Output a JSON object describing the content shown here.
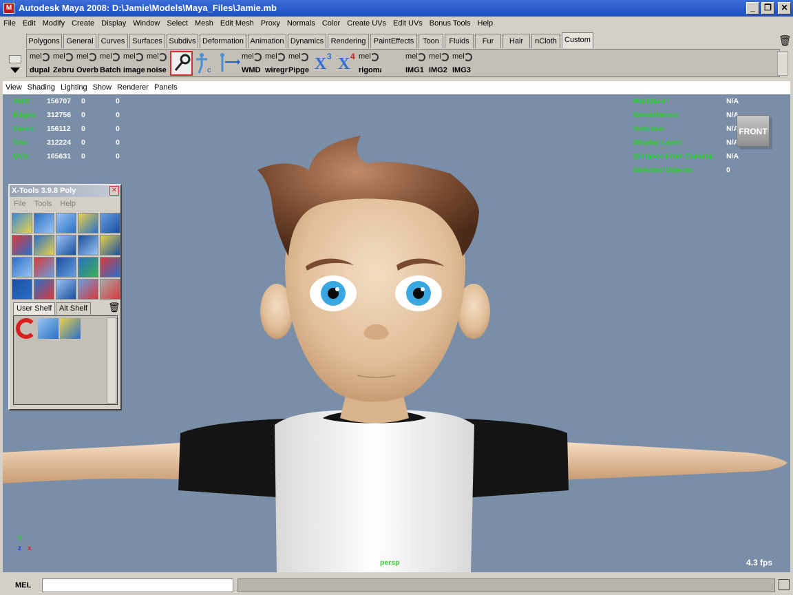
{
  "window": {
    "title": "Autodesk Maya 2008: D:\\Jamie\\Models\\Maya_Files\\Jamie.mb"
  },
  "menubar": [
    "File",
    "Edit",
    "Modify",
    "Create",
    "Display",
    "Window",
    "Select",
    "Mesh",
    "Edit Mesh",
    "Proxy",
    "Normals",
    "Color",
    "Create UVs",
    "Edit UVs",
    "Bonus Tools",
    "Help"
  ],
  "shelf_tabs": [
    "Polygons",
    "General",
    "Curves",
    "Surfaces",
    "Subdivs",
    "Deformation",
    "Animation",
    "Dynamics",
    "Rendering",
    "PaintEffects",
    "Toon",
    "Fluids",
    "Fur",
    "Hair",
    "nCloth",
    "Custom"
  ],
  "shelf_active_tab": "Custom",
  "shelf_items": [
    {
      "mel": "mel",
      "label": "dupal"
    },
    {
      "mel": "mel",
      "label": "Zebru"
    },
    {
      "mel": "mel",
      "label": "Overb"
    },
    {
      "mel": "mel",
      "label": "Batch"
    },
    {
      "mel": "mel",
      "label": "image"
    },
    {
      "mel": "mel",
      "label": "noise"
    },
    {
      "mel": "",
      "label": ""
    },
    {
      "mel": "",
      "label": ""
    },
    {
      "mel": "",
      "label": ""
    },
    {
      "mel": "mel",
      "label": "WMD"
    },
    {
      "mel": "mel",
      "label": "wiregr"
    },
    {
      "mel": "mel",
      "label": "Pipge"
    },
    {
      "mel": "",
      "label": ""
    },
    {
      "mel": "",
      "label": ""
    },
    {
      "mel": "mel",
      "label": "rigoma"
    },
    {
      "mel": "mel",
      "label": "IMG1"
    },
    {
      "mel": "mel",
      "label": "IMG2"
    },
    {
      "mel": "mel",
      "label": "IMG3"
    }
  ],
  "shelf_badges": {
    "x3": "3",
    "x4": "4"
  },
  "panel_menu": [
    "View",
    "Shading",
    "Lighting",
    "Show",
    "Renderer",
    "Panels"
  ],
  "hud_left": [
    {
      "label": "Verts:",
      "v1": "156707",
      "v2": "0",
      "v3": "0"
    },
    {
      "label": "Edges:",
      "v1": "312756",
      "v2": "0",
      "v3": "0"
    },
    {
      "label": "Faces:",
      "v1": "156112",
      "v2": "0",
      "v3": "0"
    },
    {
      "label": "Tris:",
      "v1": "312224",
      "v2": "0",
      "v3": "0"
    },
    {
      "label": "UVs:",
      "v1": "165631",
      "v2": "0",
      "v3": "0"
    }
  ],
  "hud_right": [
    {
      "label": "Backfaces:",
      "value": "N/A"
    },
    {
      "label": "Smoothness:",
      "value": "N/A"
    },
    {
      "label": "Instance:",
      "value": "N/A"
    },
    {
      "label": "Display Layer:",
      "value": "N/A"
    },
    {
      "label": "Distance From Camera:",
      "value": "N/A"
    },
    {
      "label": "Selected Objects:",
      "value": "0"
    }
  ],
  "viewcube_label": "FRONT",
  "camera_name": "persp",
  "fps": "4.3 fps",
  "axis": {
    "y": "y",
    "z": "z",
    "x": "x"
  },
  "xtools": {
    "title": "X-Tools 3.9.8 Poly",
    "menu": [
      "File",
      "Tools",
      "Help"
    ],
    "tabs": [
      "User Shelf",
      "Alt Shelf"
    ]
  },
  "mel_label": "MEL",
  "colors": {
    "viewport_bg": "#7a8ea8",
    "hud_green": "#2ad42a",
    "title_blue": "#1c4fbf"
  }
}
